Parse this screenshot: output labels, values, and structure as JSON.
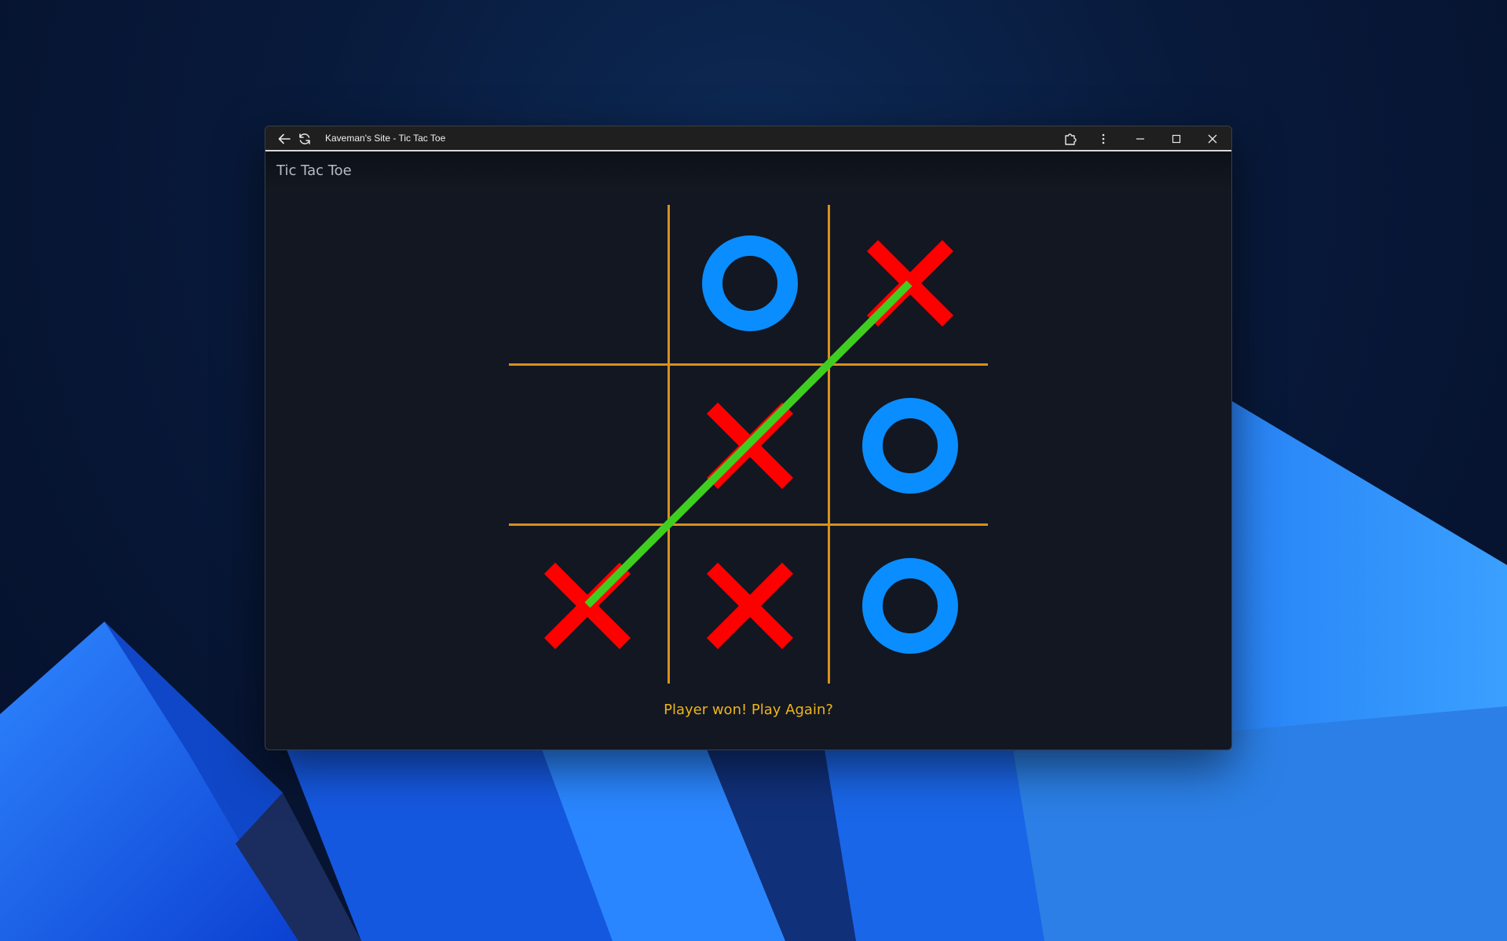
{
  "window": {
    "title": "Kaveman's Site - Tic Tac Toe"
  },
  "page": {
    "title": "Tic Tac Toe"
  },
  "game": {
    "board": [
      [
        "",
        "O",
        "X"
      ],
      [
        "",
        "X",
        "O"
      ],
      [
        "X",
        "X",
        "O"
      ]
    ],
    "winning_line": "anti-diagonal",
    "status": "Player won! Play Again?"
  },
  "icons": {
    "back": "back-arrow-icon",
    "reload": "reload-icon",
    "extensions": "extensions-icon",
    "menu": "more-vertical-icon",
    "minimize": "minimize-icon",
    "maximize": "maximize-icon",
    "close": "close-icon"
  },
  "colors": {
    "x_mark": "#ff0000",
    "o_mark": "#0a8dff",
    "grid": "#d9901a",
    "win_line": "#3fce1f",
    "status_text": "#f0b419"
  }
}
